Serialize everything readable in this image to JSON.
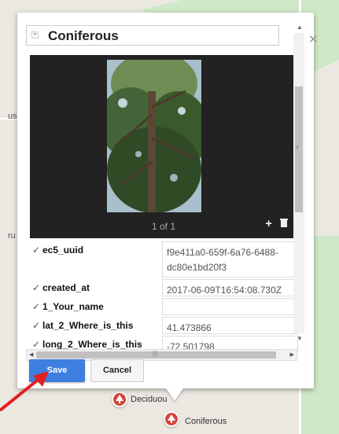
{
  "map": {
    "side_labels": [
      "us",
      "ru"
    ],
    "markers": [
      {
        "label": "Deciduou"
      },
      {
        "label": "Coniferous"
      }
    ]
  },
  "popup": {
    "title": "Coniferous",
    "viewer": {
      "count": "1 of 1"
    },
    "attributes": [
      {
        "key": "ec5_uuid",
        "value": "f9e411a0-659f-6a76-6488-dc80e1bd20f3"
      },
      {
        "key": "created_at",
        "value": "2017-06-09T16:54:08.730Z"
      },
      {
        "key": "1_Your_name",
        "value": ""
      },
      {
        "key": "lat_2_Where_is_this",
        "value": "41.473866"
      },
      {
        "key": "long_2_Where_is_this",
        "value": "-72.501798"
      }
    ],
    "buttons": {
      "save": "Save",
      "cancel": "Cancel"
    },
    "colors": {
      "save": "#3d7ee0",
      "marker": "#d4463a",
      "arrow": "#e02020"
    }
  }
}
